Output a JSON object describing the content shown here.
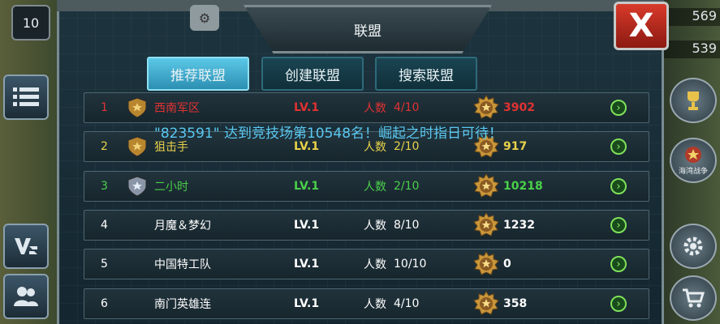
{
  "level_badge": "10",
  "resources": {
    "top": "569",
    "second": "539"
  },
  "right_buttons": {
    "war_label": "海湾战争"
  },
  "title": "联盟",
  "close_label": "X",
  "tabs": [
    {
      "label": "推荐联盟",
      "active": true
    },
    {
      "label": "创建联盟",
      "active": false
    },
    {
      "label": "搜索联盟",
      "active": false
    }
  ],
  "count_label": "人数",
  "rows": [
    {
      "rank": "1",
      "name": "西南军区",
      "level": "LV.1",
      "count": "4/10",
      "score": "3902",
      "color": "#e03232",
      "shield": "gold"
    },
    {
      "rank": "2",
      "name": "狙击手",
      "level": "LV.1",
      "count": "2/10",
      "score": "917",
      "color": "#e8d24a",
      "shield": "gold"
    },
    {
      "rank": "3",
      "name": "二小时",
      "level": "LV.1",
      "count": "2/10",
      "score": "10218",
      "color": "#4ad04a",
      "shield": "silver"
    },
    {
      "rank": "4",
      "name": "月魔＆梦幻",
      "level": "LV.1",
      "count": "8/10",
      "score": "1232",
      "color": "#ffffff",
      "shield": "none"
    },
    {
      "rank": "5",
      "name": "中国特工队",
      "level": "LV.1",
      "count": "10/10",
      "score": "0",
      "color": "#ffffff",
      "shield": "none"
    },
    {
      "rank": "6",
      "name": "南门英雄连",
      "level": "LV.1",
      "count": "4/10",
      "score": "358",
      "color": "#ffffff",
      "shield": "none"
    }
  ],
  "ticker": "\"823591\" 达到竞技场第10548名！崛起之时指日可待！"
}
